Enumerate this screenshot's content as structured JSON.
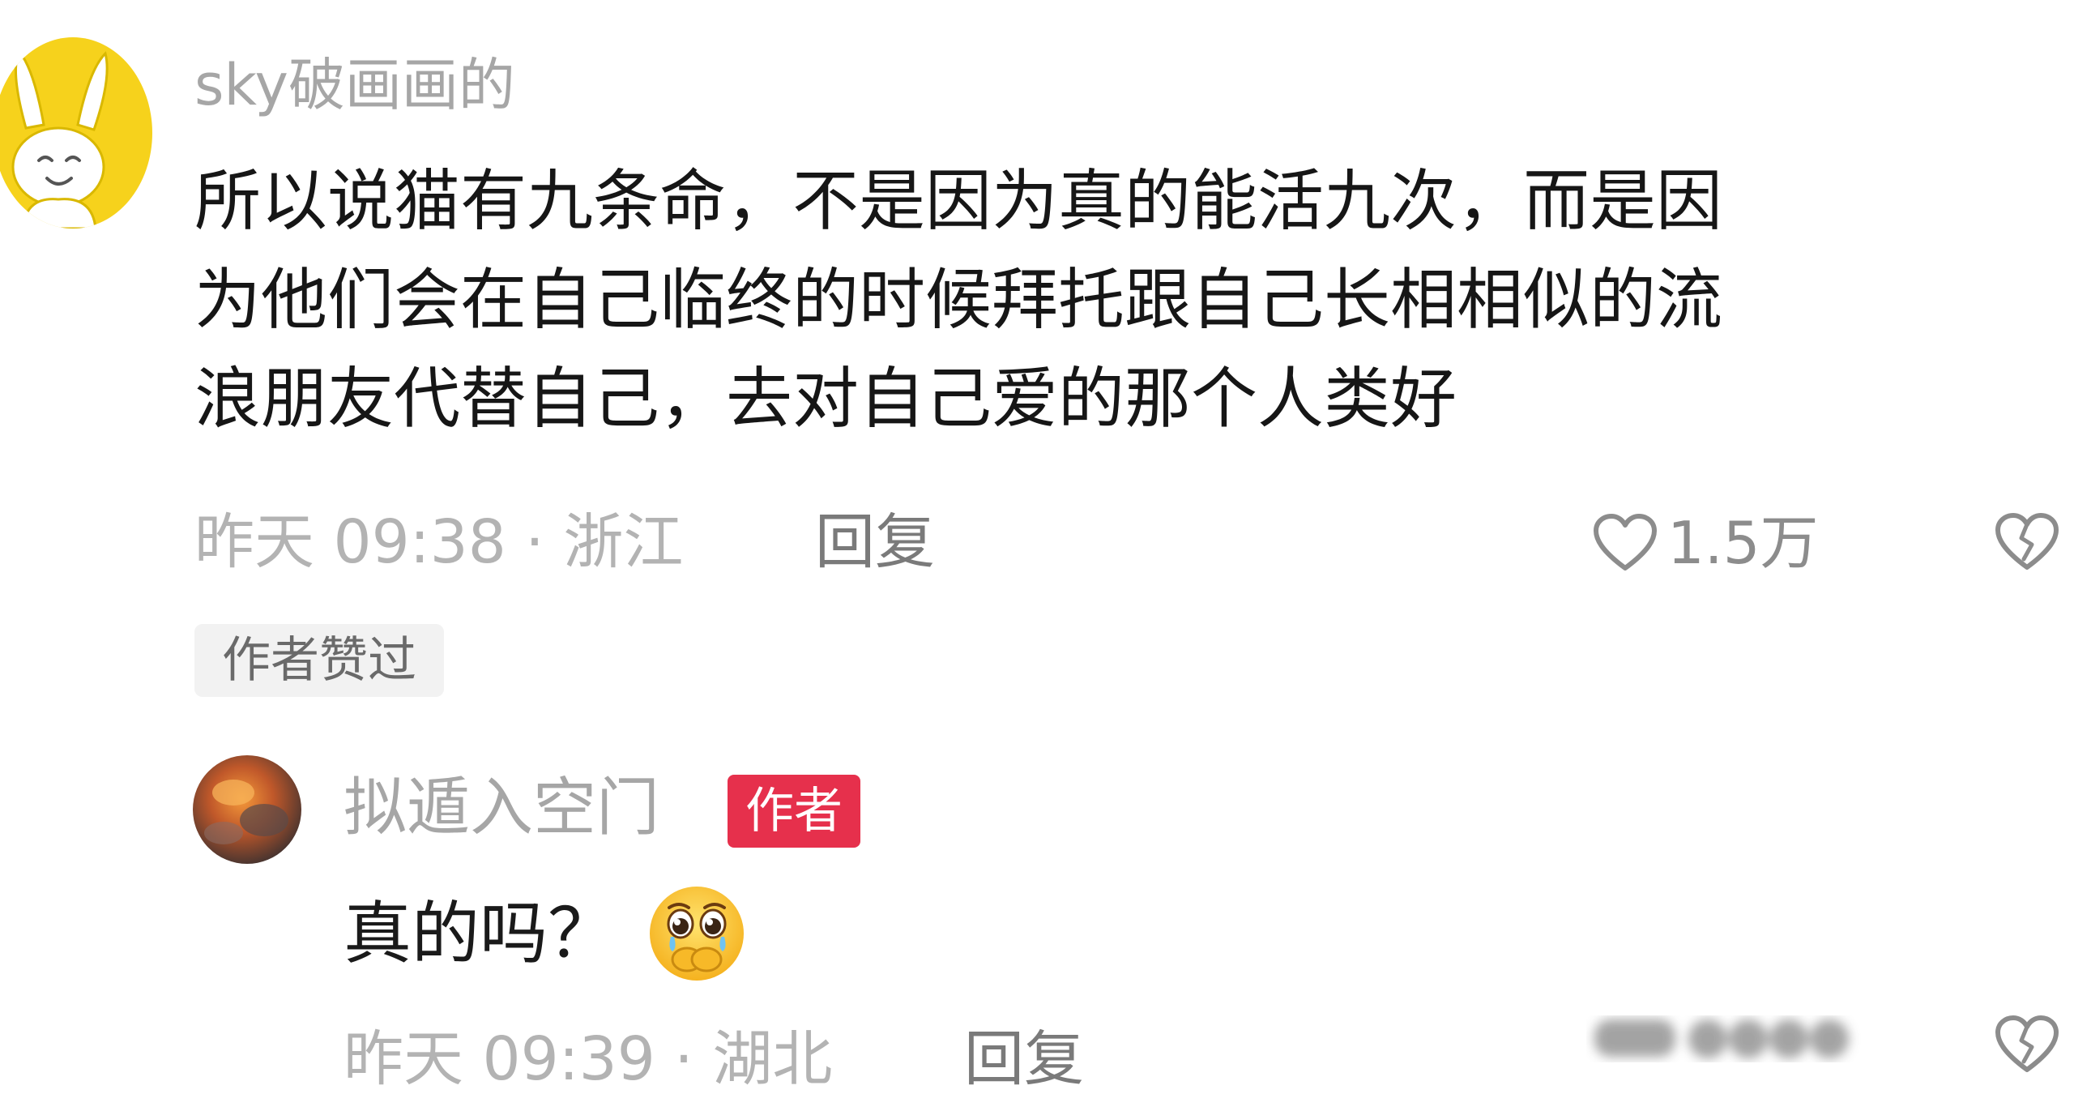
{
  "comment": {
    "username": "sky破画画的",
    "body_lines": [
      "所以说猫有九条命，不是因为真的能活九次，而是因",
      "为他们会在自己临终的时候拜托跟自己长相相似的流",
      "浪朋友代替自己，去对自己爱的那个人类好"
    ],
    "meta": "昨天 09:38 · 浙江",
    "reply_label": "回复",
    "like_count": "1.5万",
    "author_liked_tag": "作者赞过",
    "icons": {
      "avatar": "cartoon-rabbit-avatar",
      "like": "heart-outline-icon",
      "dislike": "broken-heart-icon"
    }
  },
  "reply": {
    "username": "拟遁入空门",
    "badge": "作者",
    "body": "真的吗？",
    "emoji": "pleading-face-emoji",
    "meta": "昨天 09:39 · 湖北",
    "reply_label": "回复",
    "icons": {
      "avatar": "fire-photo-avatar",
      "dislike": "broken-heart-icon"
    }
  },
  "colors": {
    "meta_gray": "#b3b3b3",
    "author_badge_red": "#e6304c",
    "avatar_yellow": "#f6d21c",
    "tag_bg": "#f2f2f2"
  }
}
